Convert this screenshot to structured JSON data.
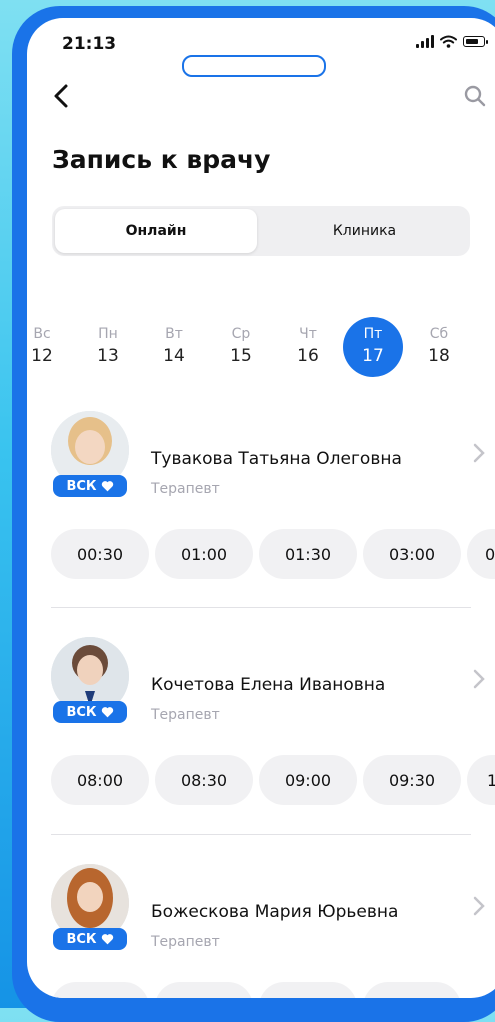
{
  "status_bar": {
    "time": "21:13"
  },
  "header": {
    "title": "Запись к врачу"
  },
  "segments": {
    "online": "Онлайн",
    "clinic": "Клиника"
  },
  "days": [
    {
      "name": "Вс",
      "num": "12"
    },
    {
      "name": "Пн",
      "num": "13"
    },
    {
      "name": "Вт",
      "num": "14"
    },
    {
      "name": "Ср",
      "num": "15"
    },
    {
      "name": "Чт",
      "num": "16"
    },
    {
      "name": "Пт",
      "num": "17"
    },
    {
      "name": "Сб",
      "num": "18"
    }
  ],
  "selected_day_index": 5,
  "accent_color": "#1a73e8",
  "doctors": [
    {
      "name": "Тувакова Татьяна Олеговна",
      "specialty": "Терапевт",
      "badge": "ВСК",
      "slots": [
        "00:30",
        "01:00",
        "01:30",
        "03:00",
        "0"
      ]
    },
    {
      "name": "Кочетова Елена Ивановна",
      "specialty": "Терапевт",
      "badge": "ВСК",
      "slots": [
        "08:00",
        "08:30",
        "09:00",
        "09:30",
        "1"
      ]
    },
    {
      "name": "Божескова Мария Юрьевна",
      "specialty": "Терапевт",
      "badge": "ВСК",
      "slots": [
        "",
        "",
        "",
        ""
      ]
    }
  ]
}
